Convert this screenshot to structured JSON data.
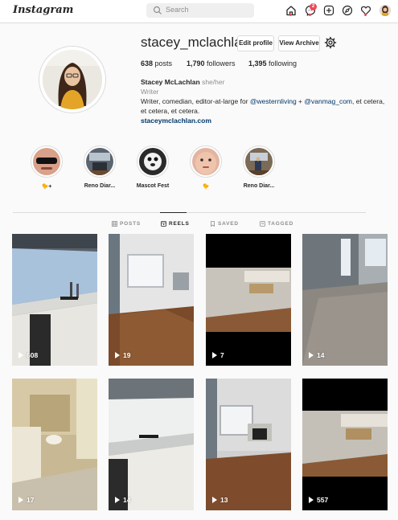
{
  "nav": {
    "logo": "Instagram",
    "search_placeholder": "Search",
    "messages_badge": "2"
  },
  "profile": {
    "username": "stacey_mclachlan",
    "edit_button": "Edit profile",
    "archive_button": "View Archive",
    "stats": {
      "posts_count": "638",
      "posts_label": "posts",
      "followers_count": "1,790",
      "followers_label": "followers",
      "following_count": "1,395",
      "following_label": "following"
    },
    "name": "Stacey McLachlan",
    "pronouns": "she/her",
    "category": "Writer",
    "bio_line_prefix": "Writer, comedian, editor-at-large for ",
    "mention1": "@westernliving",
    "bio_plus": " + ",
    "mention2": "@vanmag_com",
    "bio_suffix": ", et cetera, et cetera, et cetera.",
    "website": "staceymclachlan.com"
  },
  "highlights": [
    {
      "label": "🐤+"
    },
    {
      "label": "Reno Diar..."
    },
    {
      "label": "Mascot Fest"
    },
    {
      "label": "🐤"
    },
    {
      "label": "Reno Diar..."
    }
  ],
  "tabs": [
    {
      "label": "POSTS"
    },
    {
      "label": "REELS"
    },
    {
      "label": "SAVED"
    },
    {
      "label": "TAGGED"
    }
  ],
  "active_tab": "REELS",
  "reels": [
    {
      "views": "608"
    },
    {
      "views": "19"
    },
    {
      "views": "7"
    },
    {
      "views": "14"
    },
    {
      "views": "17"
    },
    {
      "views": "14"
    },
    {
      "views": "13"
    },
    {
      "views": "557"
    }
  ],
  "colors": {
    "link": "#00376b",
    "badge": "#ed4956",
    "border": "#dbdbdb"
  }
}
